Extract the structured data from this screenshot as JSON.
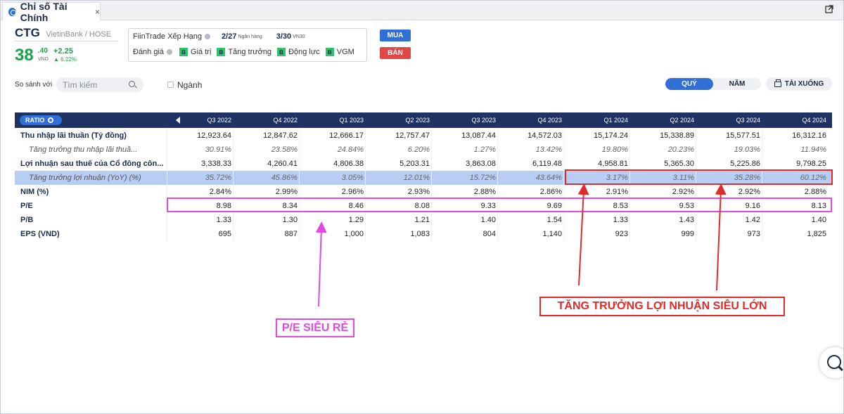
{
  "tab": {
    "title": "Chỉ số Tài Chính",
    "close": "×"
  },
  "stock": {
    "symbol": "CTG",
    "exchange": "VietinBank / HOSE",
    "price_int": "38",
    "price_dec": ".40",
    "price_unit": "VND",
    "change": "+2.25",
    "change_pct": "6.22%"
  },
  "ranking": {
    "label": "FiinTrade Xếp Hạng",
    "rank1": "2/27",
    "rank1_sub": "Ngân hàng",
    "rank2": "3/30",
    "rank2_sub": "VN30",
    "grade_label": "Đánh giá",
    "grades": [
      {
        "badge": "B",
        "label": "Giá trị"
      },
      {
        "badge": "B",
        "label": "Tăng trưởng"
      },
      {
        "badge": "B",
        "label": "Động lực"
      },
      {
        "badge": "B",
        "label": "VGM"
      }
    ]
  },
  "actions": {
    "buy": "MUA",
    "sell": "BÁN"
  },
  "compare": {
    "label": "So sánh với",
    "search_placeholder": "Tìm kiếm",
    "industry": "Ngành"
  },
  "period": {
    "quarter": "QUÝ",
    "year": "NĂM",
    "download": "TẢI XUỐNG"
  },
  "table": {
    "ratio_label": "RATIO",
    "columns": [
      "Q3 2022",
      "Q4 2022",
      "Q1 2023",
      "Q2 2023",
      "Q3 2023",
      "Q4 2023",
      "Q1 2024",
      "Q2 2024",
      "Q3 2024",
      "Q4 2024"
    ],
    "rows": [
      {
        "label": "Thu nhập lãi thuần (Tỷ đồng)",
        "sub": false,
        "values": [
          "12,923.64",
          "12,847.62",
          "12,666.17",
          "12,757.47",
          "13,087.44",
          "14,572.03",
          "15,174.24",
          "15,338.89",
          "15,577.51",
          "16,312.16"
        ]
      },
      {
        "label": "Tăng trưởng thu nhập lãi thuầ...",
        "sub": true,
        "values": [
          "30.91%",
          "23.58%",
          "24.84%",
          "6.20%",
          "1.27%",
          "13.42%",
          "19.80%",
          "20.23%",
          "19.03%",
          "11.94%"
        ]
      },
      {
        "label": "Lợi nhuận sau thuế của Cổ đông côn...",
        "sub": false,
        "values": [
          "3,338.33",
          "4,260.41",
          "4,806.38",
          "5,203.31",
          "3,863.08",
          "6,119.48",
          "4,958.81",
          "5,365.30",
          "5,225.86",
          "9,798.25"
        ]
      },
      {
        "label": "Tăng trưởng lợi nhuận (YoY) (%)",
        "sub": true,
        "values": [
          "35.72%",
          "45.86%",
          "3.05%",
          "12.01%",
          "15.72%",
          "43.64%",
          "3.17%",
          "3.11%",
          "35.28%",
          "60.12%"
        ]
      },
      {
        "label": "NIM (%)",
        "sub": false,
        "values": [
          "2.84%",
          "2.99%",
          "2.96%",
          "2.93%",
          "2.88%",
          "2.86%",
          "2.91%",
          "2.92%",
          "2.92%",
          "2.88%"
        ]
      },
      {
        "label": "P/E",
        "sub": false,
        "values": [
          "8.98",
          "8.34",
          "8.46",
          "8.08",
          "9.33",
          "9.69",
          "8.53",
          "9.53",
          "9.16",
          "8.13"
        ]
      },
      {
        "label": "P/B",
        "sub": false,
        "values": [
          "1.33",
          "1.30",
          "1.29",
          "1.21",
          "1.40",
          "1.54",
          "1.33",
          "1.43",
          "1.42",
          "1.40"
        ]
      },
      {
        "label": "EPS (VND)",
        "sub": false,
        "values": [
          "695",
          "887",
          "1,000",
          "1,083",
          "804",
          "1,140",
          "923",
          "999",
          "973",
          "1,825"
        ]
      }
    ]
  },
  "annotations": {
    "pe": "P/E SIÊU RẺ",
    "profit": "TĂNG TRƯỞNG LỢI NHUẬN SIÊU LỚN",
    "pink_color": "#e04ae0",
    "red_color": "#e02b2b"
  }
}
